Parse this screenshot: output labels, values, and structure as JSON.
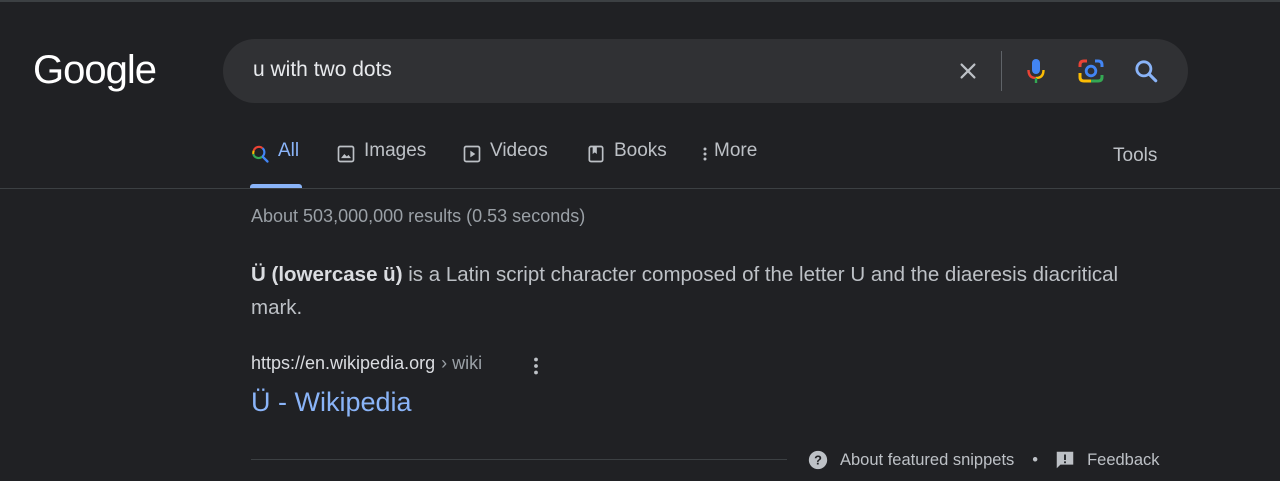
{
  "logo": "Google",
  "search": {
    "query": "u with two dots"
  },
  "tabs": [
    {
      "label": "All"
    },
    {
      "label": "Images"
    },
    {
      "label": "Videos"
    },
    {
      "label": "Books"
    },
    {
      "label": "More"
    }
  ],
  "tools_label": "Tools",
  "result_stats": "About 503,000,000 results (0.53 seconds)",
  "featured_snippet": {
    "bold_text": "Ü (lowercase ü)",
    "text": " is a Latin script character composed of the letter U and the diaeresis diacritical mark.",
    "cite_domain": "https://en.wikipedia.org",
    "cite_path": "› wiki",
    "title": "Ü - Wikipedia"
  },
  "footer": {
    "about_label": "About featured snippets",
    "separator": "•",
    "feedback_label": "Feedback"
  },
  "colors": {
    "background": "#202124",
    "link": "#8ab4f8",
    "text": "#bdc1c6"
  }
}
